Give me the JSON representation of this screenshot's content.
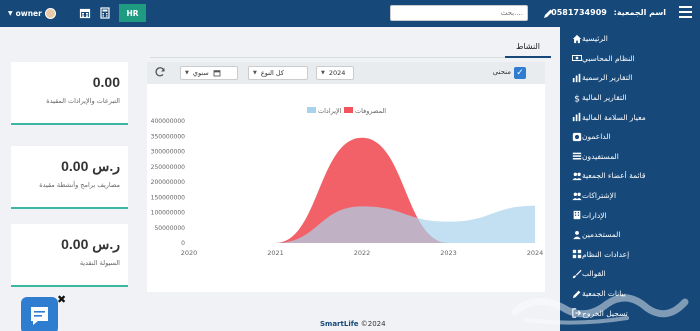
{
  "topbar": {
    "user_name": "owner",
    "hr_label": "HR",
    "search_placeholder": "بحث....",
    "association_label": "اسم الجمعية:",
    "association_phone": "0581734909"
  },
  "sidebar": {
    "items": [
      {
        "label": "الرئيسية",
        "icon": "home-icon"
      },
      {
        "label": "النظام المحاسبي",
        "icon": "money-icon"
      },
      {
        "label": "التقارير الرسمية",
        "icon": "bar-chart-icon"
      },
      {
        "label": "التقارير المالية",
        "icon": "dollar-icon"
      },
      {
        "label": "معيار السلامة المالية",
        "icon": "bar-chart-icon"
      },
      {
        "label": "الداعمون",
        "icon": "support-icon"
      },
      {
        "label": "المستفيدون",
        "icon": "list-icon"
      },
      {
        "label": "قائمة أعضاء الجمعية",
        "icon": "group-icon"
      },
      {
        "label": "الإشتراكات",
        "icon": "group-icon"
      },
      {
        "label": "الإدارات",
        "icon": "building-icon"
      },
      {
        "label": "المستخدمين",
        "icon": "users-icon"
      },
      {
        "label": "إعدادات النظام",
        "icon": "settings-icon"
      },
      {
        "label": "القوالب",
        "icon": "brush-icon"
      },
      {
        "label": "بيانات الجمعية",
        "icon": "edit-icon"
      },
      {
        "label": "تسجيل الخروج",
        "icon": "logout-icon"
      }
    ]
  },
  "tab": {
    "label": "النشاط"
  },
  "cards": [
    {
      "value": "0.00",
      "label": "التبرعات والإيرادات المقيدة"
    },
    {
      "value": "0.00 ر.س",
      "label": "مصاريف برامج وأنشطة مقيدة"
    },
    {
      "value": "0.00 ر.س",
      "label": "السيولة النقدية"
    }
  ],
  "toolbar": {
    "curve_label": "منحنى",
    "year_value": "2024",
    "type_value": "كل النوع",
    "period_value": "سنوي"
  },
  "chart_data": {
    "type": "area",
    "legend": [
      "المصروفات",
      "الإيرادات"
    ],
    "legend_position": "top",
    "x": [
      2020,
      2021,
      2022,
      2023,
      2024
    ],
    "xlim": [
      2020,
      2024
    ],
    "ylim": [
      0,
      400000000
    ],
    "y_ticks": [
      "0",
      "50000000",
      "100000000",
      "150000000",
      "200000000",
      "250000000",
      "300000000",
      "350000000",
      "400000000"
    ],
    "x_ticks": [
      "2020",
      "2021",
      "2022",
      "2023",
      "2024"
    ],
    "series": [
      {
        "name": "المصروفات",
        "color": "#f2545b",
        "values": [
          0,
          0,
          345000000,
          0,
          0
        ]
      },
      {
        "name": "الإيرادات",
        "color": "#a9d3ec",
        "values": [
          0,
          0,
          120000000,
          70000000,
          122000000
        ]
      }
    ]
  },
  "footer": {
    "copyright": "©2024",
    "brand": "SmartLife"
  },
  "colors": {
    "primary": "#16497a",
    "accent": "#1f9b82",
    "card_border": "#3db6a4"
  }
}
